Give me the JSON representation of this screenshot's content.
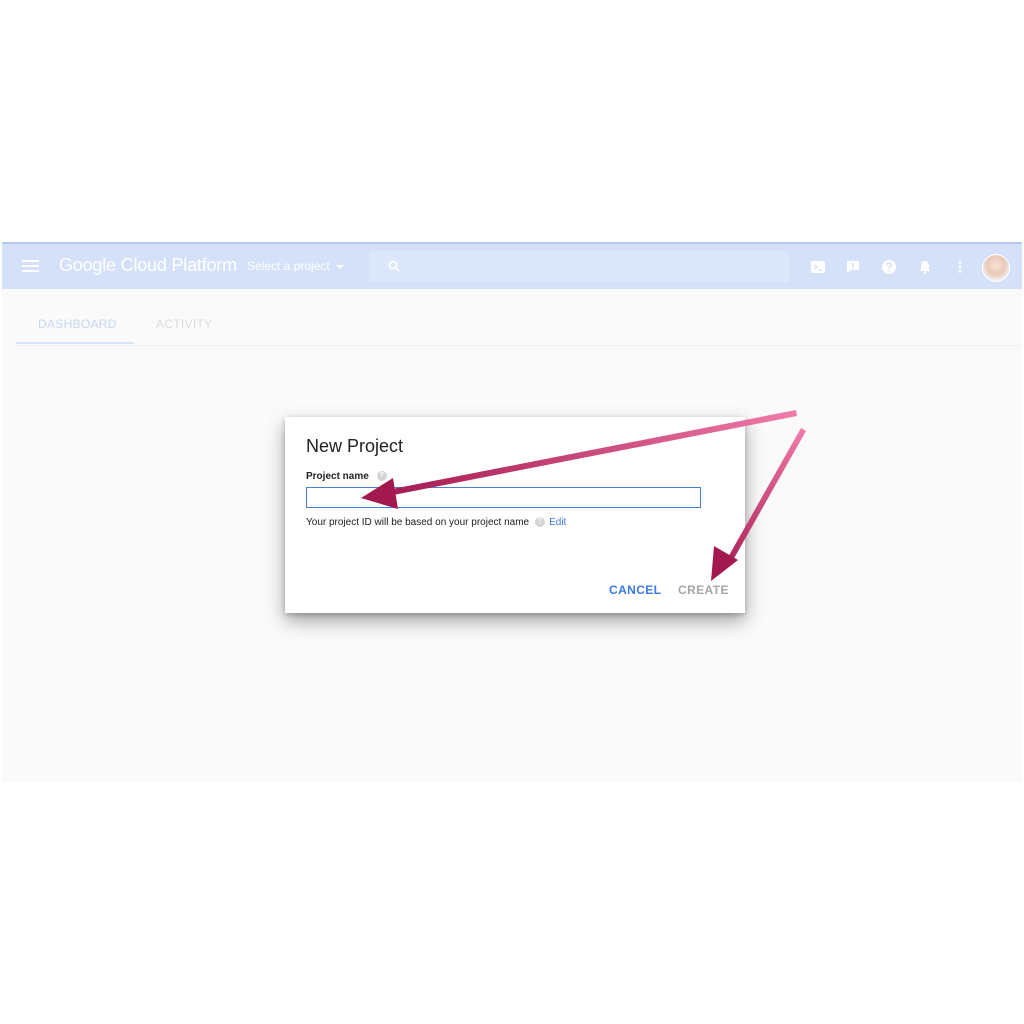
{
  "header": {
    "brand": "Google Cloud Platform",
    "project_selector": "Select a project",
    "icons": [
      "menu-icon",
      "search-icon",
      "cloud-shell-icon",
      "feedback-icon",
      "help-icon",
      "notifications-icon",
      "more-vert-icon",
      "avatar"
    ]
  },
  "tabs": [
    {
      "label": "DASHBOARD",
      "active": true
    },
    {
      "label": "ACTIVITY",
      "active": false
    }
  ],
  "dialog": {
    "title": "New Project",
    "field_label": "Project name",
    "field_value": "",
    "hint": "Your project ID will be based on your project name",
    "edit_link": "Edit",
    "cancel_label": "CANCEL",
    "create_label": "CREATE"
  },
  "colors": {
    "appbar": "#d4e1f9",
    "accent_blue": "#3b78e7",
    "annotation_arrow": "#b01e5c"
  }
}
